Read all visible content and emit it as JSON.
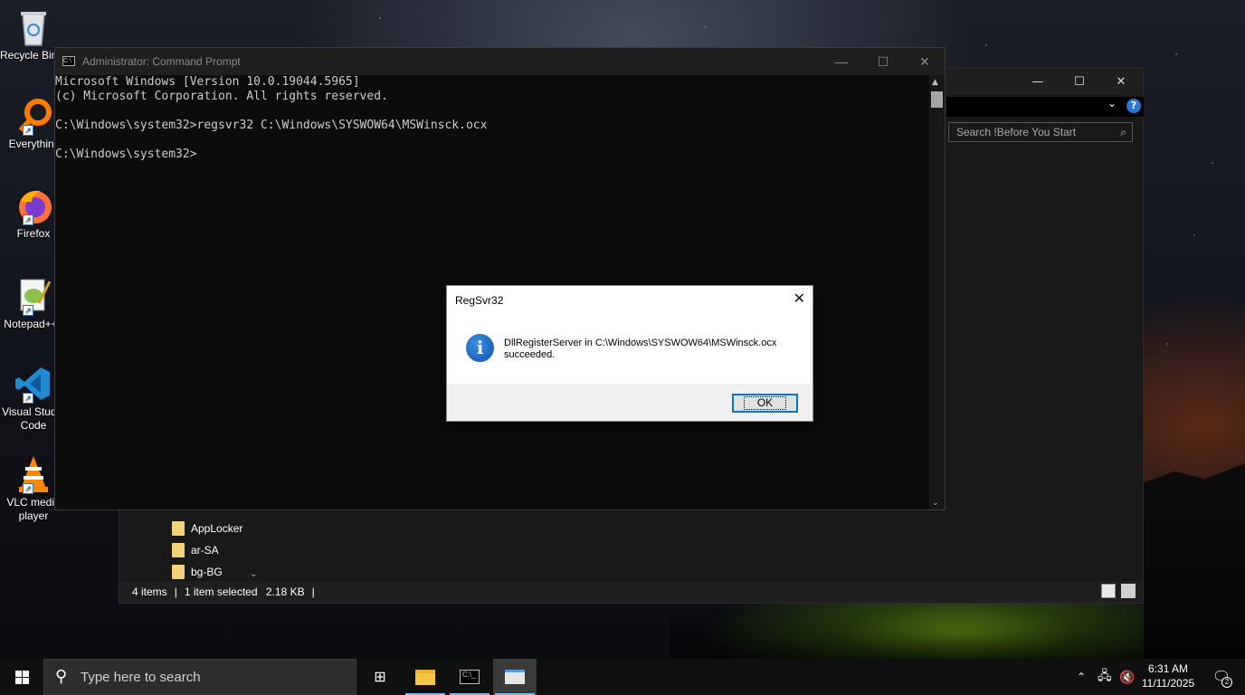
{
  "desktop": {
    "icons": [
      {
        "label": "Recycle Bin",
        "icon": "recycle-bin-icon"
      },
      {
        "label": "Everything",
        "icon": "everything-search-icon"
      },
      {
        "label": "Firefox",
        "icon": "firefox-icon"
      },
      {
        "label": "Notepad++",
        "icon": "notepad-plus-plus-icon"
      },
      {
        "label": "Visual Studio Code",
        "icon": "vscode-icon"
      },
      {
        "label": "VLC media player",
        "icon": "vlc-icon"
      }
    ]
  },
  "explorer": {
    "search_placeholder": "Search !Before You Start",
    "folders": [
      "AppLocker",
      "ar-SA",
      "bg-BG"
    ],
    "status": {
      "items": "4 items",
      "selected": "1 item selected",
      "size": "2.18 KB"
    }
  },
  "cmd": {
    "title": "Administrator: Command Prompt",
    "lines": [
      "Microsoft Windows [Version 10.0.19044.5965]",
      "(c) Microsoft Corporation. All rights reserved.",
      "",
      "C:\\Windows\\system32>regsvr32 C:\\Windows\\SYSWOW64\\MSWinsck.ocx",
      "",
      "C:\\Windows\\system32>"
    ]
  },
  "dialog": {
    "title": "RegSvr32",
    "message_line1": "DllRegisterServer in C:\\Windows\\SYSWOW64\\MSWinsck.ocx",
    "message_line2": "succeeded.",
    "ok_label": "OK"
  },
  "taskbar": {
    "search_placeholder": "Type here to search",
    "time": "6:31 AM",
    "date": "11/11/2025",
    "notification_count": "2"
  },
  "colors": {
    "accent": "#0078d7",
    "info_icon": "#1b64c2",
    "console_text": "#cccccc",
    "taskbar": "#101010"
  }
}
